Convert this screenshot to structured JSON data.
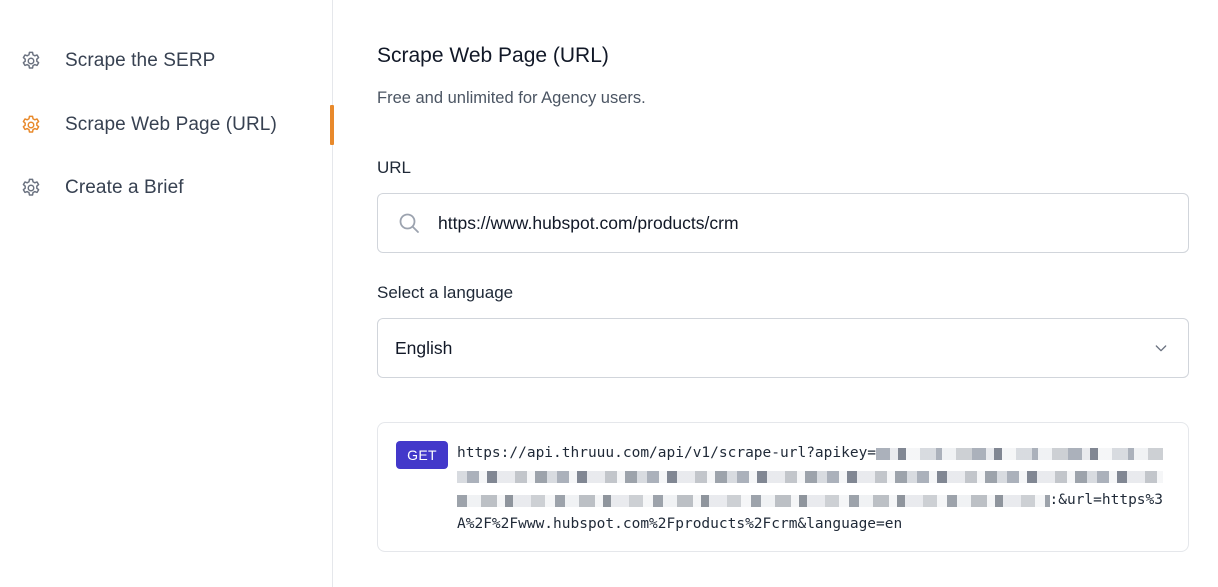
{
  "sidebar": {
    "items": [
      {
        "label": "Scrape the SERP",
        "icon": "gear-icon",
        "active": false
      },
      {
        "label": "Scrape Web Page (URL)",
        "icon": "gear-icon",
        "active": true
      },
      {
        "label": "Create a Brief",
        "icon": "gear-icon",
        "active": false
      }
    ]
  },
  "main": {
    "title": "Scrape Web Page (URL)",
    "subtitle": "Free and unlimited for Agency users.",
    "url_field": {
      "label": "URL",
      "value": "https://www.hubspot.com/products/crm",
      "icon": "search-icon"
    },
    "language_field": {
      "label": "Select a language",
      "value": "English",
      "icon": "chevron-down-icon"
    },
    "request": {
      "method": "GET",
      "line1": "https://api.thruuu.com/api/v1/scrape-url?apikey=",
      "line3_tail": ":&url=https%3",
      "line4": "A%2F%2Fwww.hubspot.com%2Fproducts%2Fcrm&language=en"
    }
  },
  "colors": {
    "accent": "#e8892b",
    "method_badge": "#4338ca",
    "border": "#d1d5db"
  }
}
